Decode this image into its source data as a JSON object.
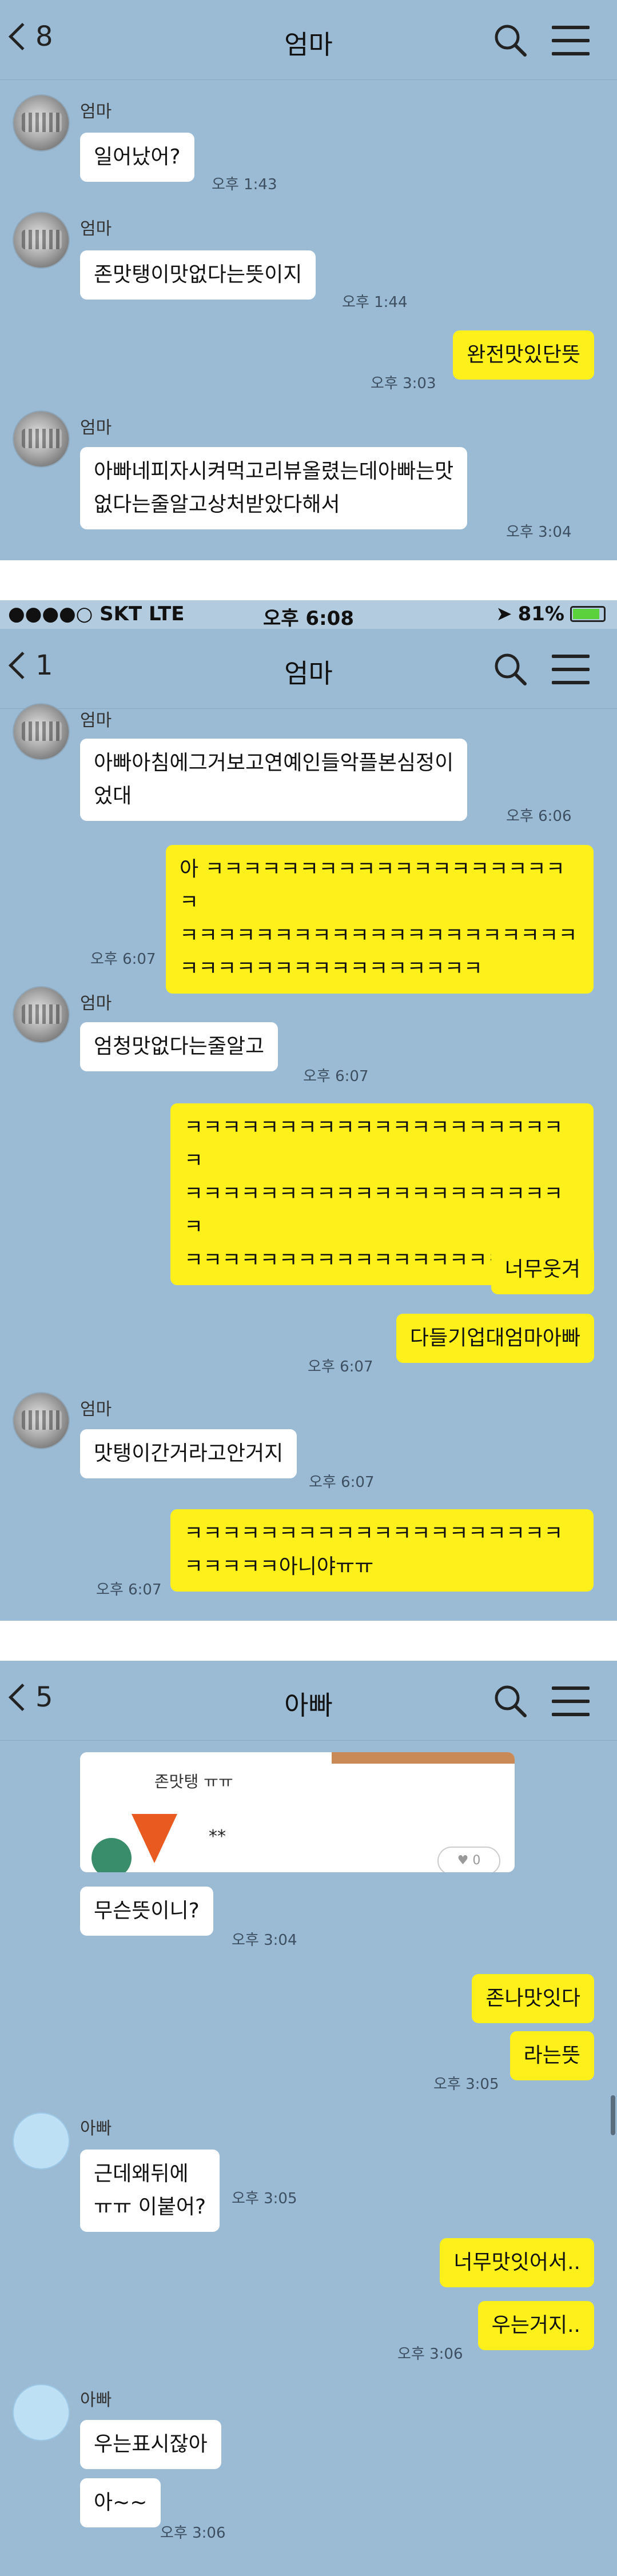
{
  "panel1": {
    "back_count": "8",
    "title": "엄마",
    "messages": [
      {
        "name": "엄마",
        "text": "일어났어?",
        "time": "오후 1:43"
      },
      {
        "name": "엄마",
        "text": "존맛탱이맛없다는뜻이지",
        "time": "오후 1:44"
      },
      {
        "text": "완전맛있단뜻",
        "time": "오후 3:03"
      },
      {
        "name": "엄마",
        "text": "아빠네피자시켜먹고리뷰올렸는데아빠는맛\n없다는줄알고상처받았다해서",
        "time": "오후 3:04"
      }
    ]
  },
  "panel2": {
    "status": {
      "left": "●●●●○ SKT  LTE",
      "time": "오후 6:08",
      "right": "81%"
    },
    "back_count": "1",
    "title": "엄마",
    "messages": [
      {
        "name": "엄마",
        "text": "아빠아침에그거보고연예인들악플본심정이\n었대",
        "time": "오후 6:06"
      },
      {
        "text": "아 ㅋㅋㅋㅋㅋㅋㅋㅋㅋㅋㅋㅋㅋㅋㅋㅋㅋㅋㅋㅋ\nㅋㅋㅋㅋㅋㅋㅋㅋㅋㅋㅋㅋㅋㅋㅋㅋㅋㅋㅋㅋㅋ\nㅋㅋㅋㅋㅋㅋㅋㅋㅋㅋㅋㅋㅋㅋㅋㅋ",
        "time": "오후 6:07"
      },
      {
        "name": "엄마",
        "text": "엄청맛없다는줄알고",
        "time": "오후 6:07"
      },
      {
        "text": "ㅋㅋㅋㅋㅋㅋㅋㅋㅋㅋㅋㅋㅋㅋㅋㅋㅋㅋㅋㅋㅋ\nㅋㅋㅋㅋㅋㅋㅋㅋㅋㅋㅋㅋㅋㅋㅋㅋㅋㅋㅋㅋㅋ\nㅋㅋㅋㅋㅋㅋㅋㅋㅋㅋㅋㅋㅋㅋㅋㅋㅋ"
      },
      {
        "text": "너무웃겨"
      },
      {
        "text": "다들기업대엄마아빠",
        "time": "오후 6:07"
      },
      {
        "name": "엄마",
        "text": "맛탱이간거라고안거지",
        "time": "오후 6:07"
      },
      {
        "text": "ㅋㅋㅋㅋㅋㅋㅋㅋㅋㅋㅋㅋㅋㅋㅋㅋㅋㅋㅋㅋ\nㅋㅋㅋㅋㅋ아니야ㅠㅠ",
        "time": "오후 6:07"
      }
    ]
  },
  "panel3": {
    "back_count": "5",
    "title": "아빠",
    "photo": {
      "caption": "존맛탱 ㅠㅠ",
      "stars": "**",
      "likes": "0"
    },
    "messages": [
      {
        "text": "무슨뜻이니?",
        "time": "오후 3:04"
      },
      {
        "text": "존나맛잇다"
      },
      {
        "text": "라는뜻",
        "time": "오후 3:05"
      },
      {
        "name": "아빠",
        "text": "근데왜뒤에\nㅠㅠ 이붙어?",
        "time": "오후 3:05"
      },
      {
        "text": "너무맛잇어서.."
      },
      {
        "text": "우는거지..",
        "time": "오후 3:06"
      },
      {
        "name": "아빠",
        "text": "우는표시잖아"
      },
      {
        "text": "아~~",
        "time": "오후 3:06"
      }
    ]
  },
  "colors": {
    "background": "#9bbbd4",
    "incoming": "#ffffff",
    "outgoing": "#fef01b"
  }
}
